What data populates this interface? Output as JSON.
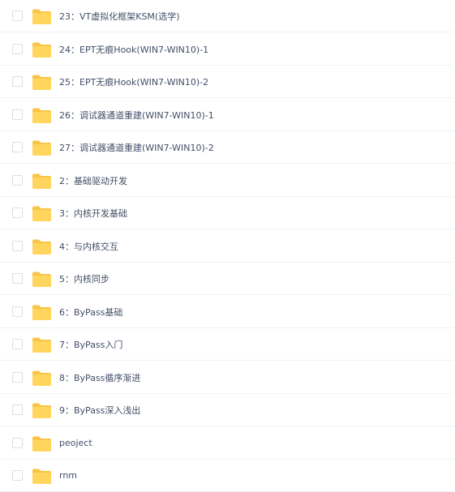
{
  "colors": {
    "folder_body": "#ffd55e",
    "folder_tab": "#f9c547",
    "text": "#424e67",
    "divider": "#f0f2f5",
    "checkbox_border": "#dcdfe5"
  },
  "icons": {
    "checkbox": "checkbox-icon",
    "folder": "folder-icon"
  },
  "files": [
    {
      "name": "23：VT虚拟化框架KSM(选学)"
    },
    {
      "name": "24：EPT无痕Hook(WIN7-WIN10)-1"
    },
    {
      "name": "25：EPT无痕Hook(WIN7-WIN10)-2"
    },
    {
      "name": "26：调试器通道重建(WIN7-WIN10)-1"
    },
    {
      "name": "27：调试器通道重建(WIN7-WIN10)-2"
    },
    {
      "name": "2：基础驱动开发"
    },
    {
      "name": "3：内核开发基础"
    },
    {
      "name": "4：与内核交互"
    },
    {
      "name": "5：内核同步"
    },
    {
      "name": "6：ByPass基础"
    },
    {
      "name": "7：ByPass入门"
    },
    {
      "name": "8：ByPass循序渐进"
    },
    {
      "name": "9：ByPass深入浅出"
    },
    {
      "name": "peoject"
    },
    {
      "name": "rnm"
    }
  ]
}
